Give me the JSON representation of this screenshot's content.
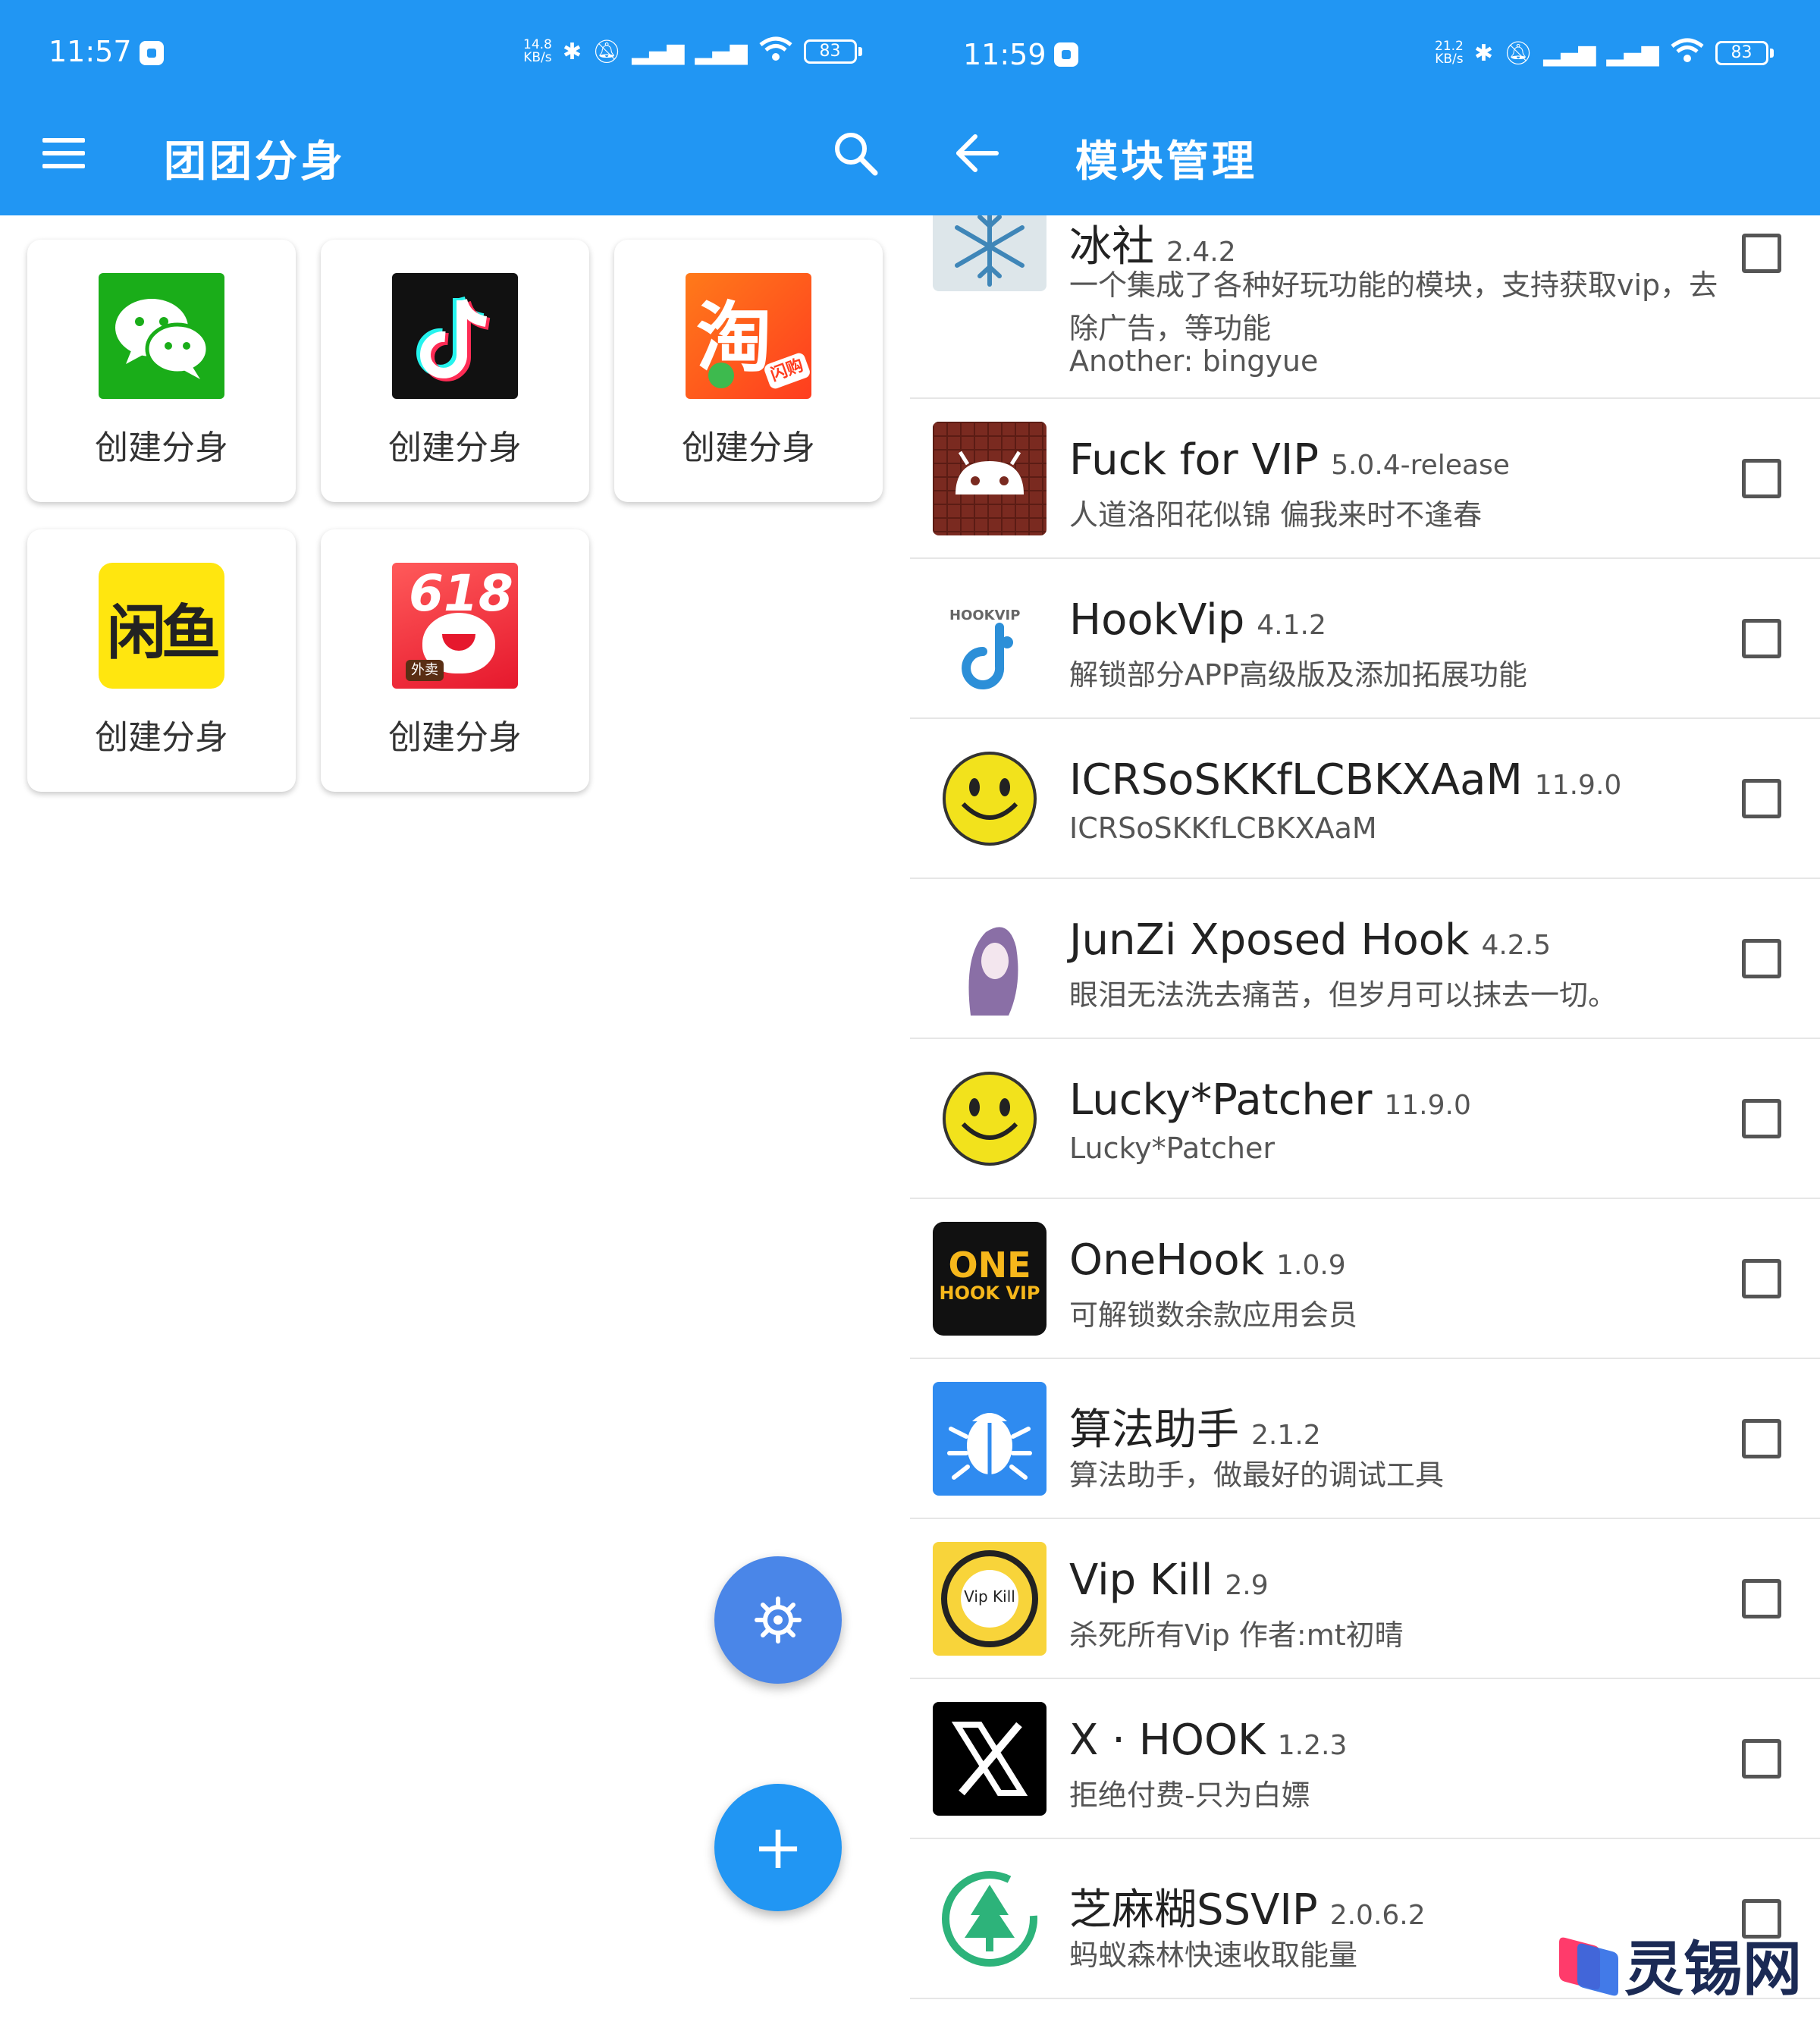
{
  "left": {
    "status": {
      "time": "11:57",
      "speed_num": "14.8",
      "speed_unit": "KB/s",
      "battery": "83"
    },
    "title": "团团分身",
    "cards": [
      {
        "label": "创建分身",
        "app": "wechat-icon"
      },
      {
        "label": "创建分身",
        "app": "douyin-icon"
      },
      {
        "label": "创建分身",
        "app": "taobao-icon"
      },
      {
        "label": "创建分身",
        "app": "xianyu-icon"
      },
      {
        "label": "创建分身",
        "app": "meituan-618-icon"
      }
    ],
    "taobao_glyph": "淘",
    "taobao_badge": "闪购",
    "xianyu_text": "闲鱼",
    "meituan_text": "618",
    "meituan_badge": "外卖",
    "fab_add": "+"
  },
  "right": {
    "status": {
      "time": "11:59",
      "speed_num": "21.2",
      "speed_unit": "KB/s",
      "battery": "83"
    },
    "title": "模块管理",
    "modules": [
      {
        "name": "冰社",
        "version": "2.4.2",
        "desc": "一个集成了各种好玩功能的模块，支持获取vip，去",
        "desc2": "除广告，等功能",
        "desc3": "Another: bingyue",
        "icon": "snowflake-icon"
      },
      {
        "name": "Fuck for VIP",
        "version": "5.0.4-release",
        "desc": "人道洛阳花似锦 偏我来时不逢春",
        "icon": "android-icon"
      },
      {
        "name": "HookVip",
        "version": "4.1.2",
        "desc": "解锁部分APP高级版及添加拓展功能",
        "icon": "hookvip-icon",
        "icon_text": "HOOKVIP"
      },
      {
        "name": "ICRSoSKKfLCBKXAaM",
        "version": "11.9.0",
        "desc": "ICRSoSKKfLCBKXAaM",
        "icon": "smiley-icon"
      },
      {
        "name": "JunZi Xposed Hook",
        "version": "4.2.5",
        "desc": "眼泪无法洗去痛苦，但岁月可以抹去一切。",
        "icon": "portrait-icon"
      },
      {
        "name": "Lucky*Patcher",
        "version": "11.9.0",
        "desc": "Lucky*Patcher",
        "icon": "smiley-icon"
      },
      {
        "name": "OneHook",
        "version": "1.0.9",
        "desc": "可解锁数余款应用会员",
        "icon": "onehook-icon",
        "icon_line1": "ONE",
        "icon_line2": "HOOK VIP"
      },
      {
        "name": "算法助手",
        "version": "2.1.2",
        "desc": "算法助手，做最好的调试工具",
        "icon": "bug-icon"
      },
      {
        "name": "Vip Kill",
        "version": "2.9",
        "desc": "杀死所有Vip 作者:mt初晴",
        "icon": "vipkill-icon",
        "icon_text": "Vip Kill"
      },
      {
        "name": "X · HOOK",
        "version": "1.2.3",
        "desc": "拒绝付费-只为白嫖",
        "icon": "x-logo-icon"
      },
      {
        "name": "芝麻糊SSVIP",
        "version": "2.0.6.2",
        "desc": "蚂蚁森林快速收取能量",
        "icon": "tree-icon"
      }
    ]
  },
  "watermark": "灵锡网",
  "colors": {
    "primary": "#2196F3",
    "fab_secondary": "#4A86E8"
  }
}
